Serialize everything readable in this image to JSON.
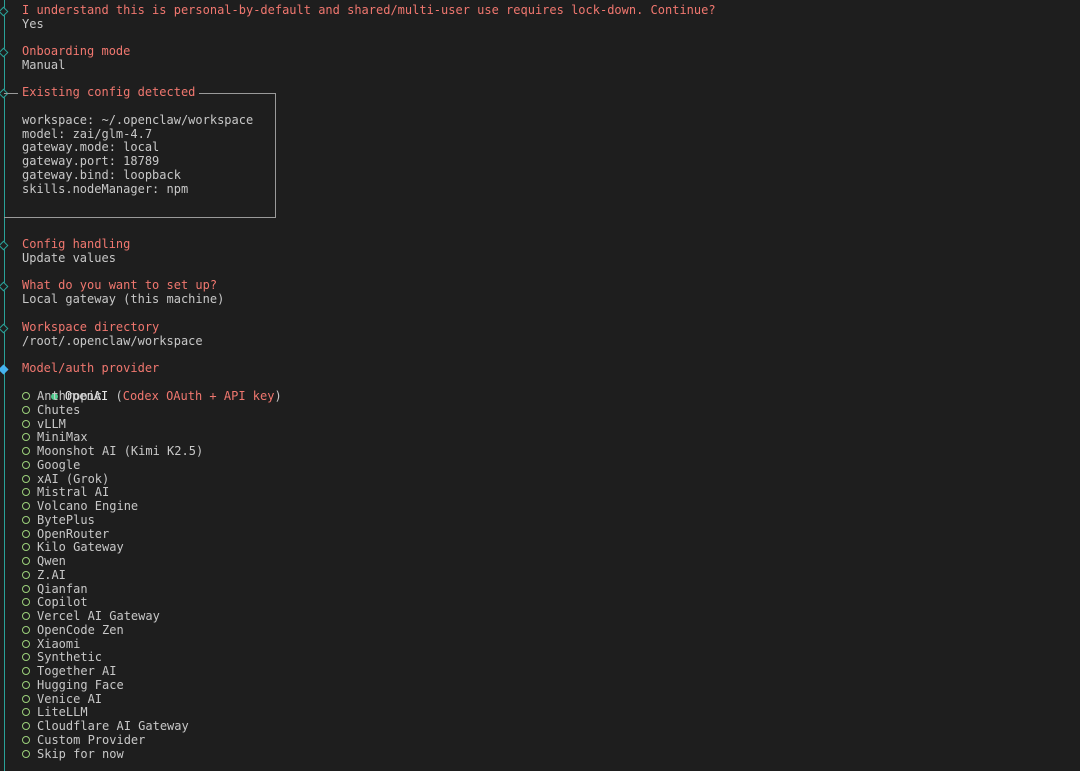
{
  "prompts": [
    {
      "question": "I understand this is personal-by-default and shared/multi-user use requires lock-down. Continue?",
      "answer": "Yes"
    },
    {
      "question": "Onboarding mode",
      "answer": "Manual"
    },
    {
      "question": "Config handling",
      "answer": "Update values"
    },
    {
      "question": "What do you want to set up?",
      "answer": "Local gateway (this machine)"
    },
    {
      "question": "Workspace directory",
      "answer": "/root/.openclaw/workspace"
    }
  ],
  "existing_config": {
    "title": "Existing config detected",
    "lines": [
      "workspace: ~/.openclaw/workspace",
      "model: zai/glm-4.7",
      "gateway.mode: local",
      "gateway.port: 18789",
      "gateway.bind: loopback",
      "skills.nodeManager: npm"
    ]
  },
  "provider_select": {
    "question": "Model/auth provider",
    "selected": {
      "label": "OpenAI",
      "hint_open": " (",
      "hint": "Codex OAuth + API key",
      "hint_close": ")"
    },
    "options": [
      "Anthropic",
      "Chutes",
      "vLLM",
      "MiniMax",
      "Moonshot AI (Kimi K2.5)",
      "Google",
      "xAI (Grok)",
      "Mistral AI",
      "Volcano Engine",
      "BytePlus",
      "OpenRouter",
      "Kilo Gateway",
      "Qwen",
      "Z.AI",
      "Qianfan",
      "Copilot",
      "Vercel AI Gateway",
      "OpenCode Zen",
      "Xiaomi",
      "Synthetic",
      "Together AI",
      "Hugging Face",
      "Venice AI",
      "LiteLLM",
      "Cloudflare AI Gateway",
      "Custom Provider",
      "Skip for now"
    ]
  },
  "colors": {
    "question": "#f0776f",
    "answer": "#c8c8c8",
    "rail": "#2aa198",
    "radio_selected": "#4ec98c",
    "radio_unselected": "#9bd07a",
    "active_marker": "#46b3ee",
    "background": "#1e1e1e"
  }
}
